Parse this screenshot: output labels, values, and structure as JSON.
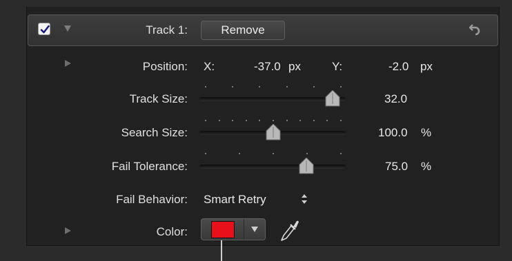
{
  "track": {
    "enabled": true,
    "title": "Track 1:",
    "remove_label": "Remove"
  },
  "position": {
    "label": "Position:",
    "x_label": "X:",
    "x_value": "-37.0",
    "x_unit": "px",
    "y_label": "Y:",
    "y_value": "-2.0",
    "y_unit": "px"
  },
  "track_size": {
    "label": "Track Size:",
    "value": "32.0",
    "slider_fraction": 0.95
  },
  "search_size": {
    "label": "Search Size:",
    "value": "100.0",
    "unit": "%",
    "slider_fraction": 0.5
  },
  "fail_tolerance": {
    "label": "Fail Tolerance:",
    "value": "75.0",
    "unit": "%",
    "slider_fraction": 0.75
  },
  "fail_behavior": {
    "label": "Fail Behavior:",
    "value": "Smart Retry"
  },
  "color": {
    "label": "Color:",
    "swatch": "#e8101a"
  },
  "icons": {
    "checkbox": "checkmark-icon",
    "disclosure": "disclosure-triangle-icon",
    "reset": "reset-arrow-icon",
    "stepper": "up-down-stepper-icon",
    "eyedropper": "eyedropper-icon"
  }
}
